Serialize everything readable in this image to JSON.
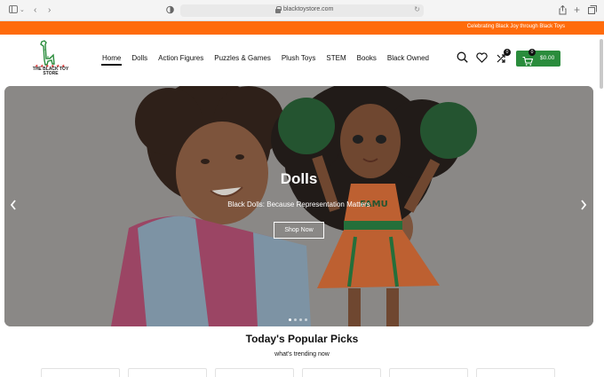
{
  "browser": {
    "url": "blacktoystore.com"
  },
  "promo": {
    "text": "Celebrating Black Joy through Black Toys"
  },
  "logo": {
    "line1": "THE BLACK TOY",
    "line2": "STORE"
  },
  "nav": [
    {
      "label": "Home",
      "active": true
    },
    {
      "label": "Dolls"
    },
    {
      "label": "Action Figures"
    },
    {
      "label": "Puzzles & Games"
    },
    {
      "label": "Plush Toys"
    },
    {
      "label": "STEM"
    },
    {
      "label": "Books"
    },
    {
      "label": "Black Owned"
    }
  ],
  "header": {
    "compare_count": "0",
    "cart_count": "0",
    "cart_total": "$0.00"
  },
  "hero": {
    "title": "Dolls",
    "subtitle": "Black Dolls: Because Representation Matters",
    "button": "Shop Now",
    "doll_shirt_text": "FAMU"
  },
  "section": {
    "title": "Today's Popular Picks",
    "subtitle": "what's trending now"
  },
  "colors": {
    "promo": "#ff6b0b",
    "cart_button": "#2a8c3c",
    "hero_bg": "#9c9a98"
  },
  "icons": [
    "sidebar-icon",
    "back-icon",
    "forward-icon",
    "shield-icon",
    "lock-icon",
    "reload-icon",
    "share-icon",
    "new-tab-icon",
    "tabs-icon",
    "search-icon",
    "heart-icon",
    "compare-icon",
    "cart-icon",
    "chevron-left-icon",
    "chevron-right-icon"
  ]
}
